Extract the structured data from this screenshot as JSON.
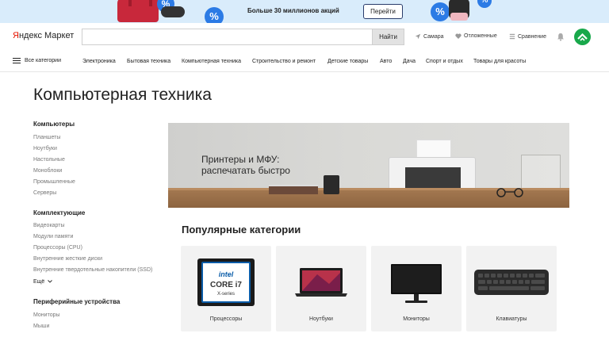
{
  "promo": {
    "text": "Больше 30 миллионов акций",
    "button": "Перейти",
    "badge": "%"
  },
  "header": {
    "logo_y": "Я",
    "logo_rest": "ндекс",
    "logo_market": "Маркет",
    "search_placeholder": "",
    "search_button": "Найти",
    "region": "Самара",
    "favorites": "Отложенные",
    "compare": "Сравнение"
  },
  "nav": {
    "all_categories": "Все категории",
    "links": [
      "Электроника",
      "Бытовая техника",
      "Компьютерная техника",
      "Строительство и ремонт",
      "Детские товары",
      "Авто",
      "Дача",
      "Спорт и отдых",
      "Товары для красоты"
    ]
  },
  "page_title": "Компьютерная техника",
  "sidebar": {
    "groups": [
      {
        "title": "Компьютеры",
        "items": [
          "Планшеты",
          "Ноутбуки",
          "Настольные",
          "Моноблоки",
          "Промышленные",
          "Серверы"
        ]
      },
      {
        "title": "Комплектующие",
        "items": [
          "Видеокарты",
          "Модули памяти",
          "Процессоры (CPU)",
          "Внутренние жесткие диски",
          "Внутренние твердотельные накопители (SSD)"
        ]
      },
      {
        "title": "Периферийные устройства",
        "items": [
          "Мониторы",
          "Мыши"
        ]
      }
    ],
    "more": "Ещё"
  },
  "hero": {
    "text": "Принтеры и МФУ:\nраспечатать быстро"
  },
  "popular": {
    "title": "Популярные категории",
    "cards": [
      {
        "label": "Процессоры",
        "icon": "cpu-icon"
      },
      {
        "label": "Ноутбуки",
        "icon": "laptop-icon"
      },
      {
        "label": "Мониторы",
        "icon": "monitor-icon"
      },
      {
        "label": "Клавиатуры",
        "icon": "keyboard-icon"
      }
    ],
    "cpu_brand": "intel",
    "cpu_model": "CORE i7",
    "cpu_series": "X-series"
  },
  "colors": {
    "promo_bg": "#d9ecfb",
    "logo_red": "#e61400",
    "avatar_green": "#18a84b",
    "card_bg": "#f2f2f2"
  }
}
